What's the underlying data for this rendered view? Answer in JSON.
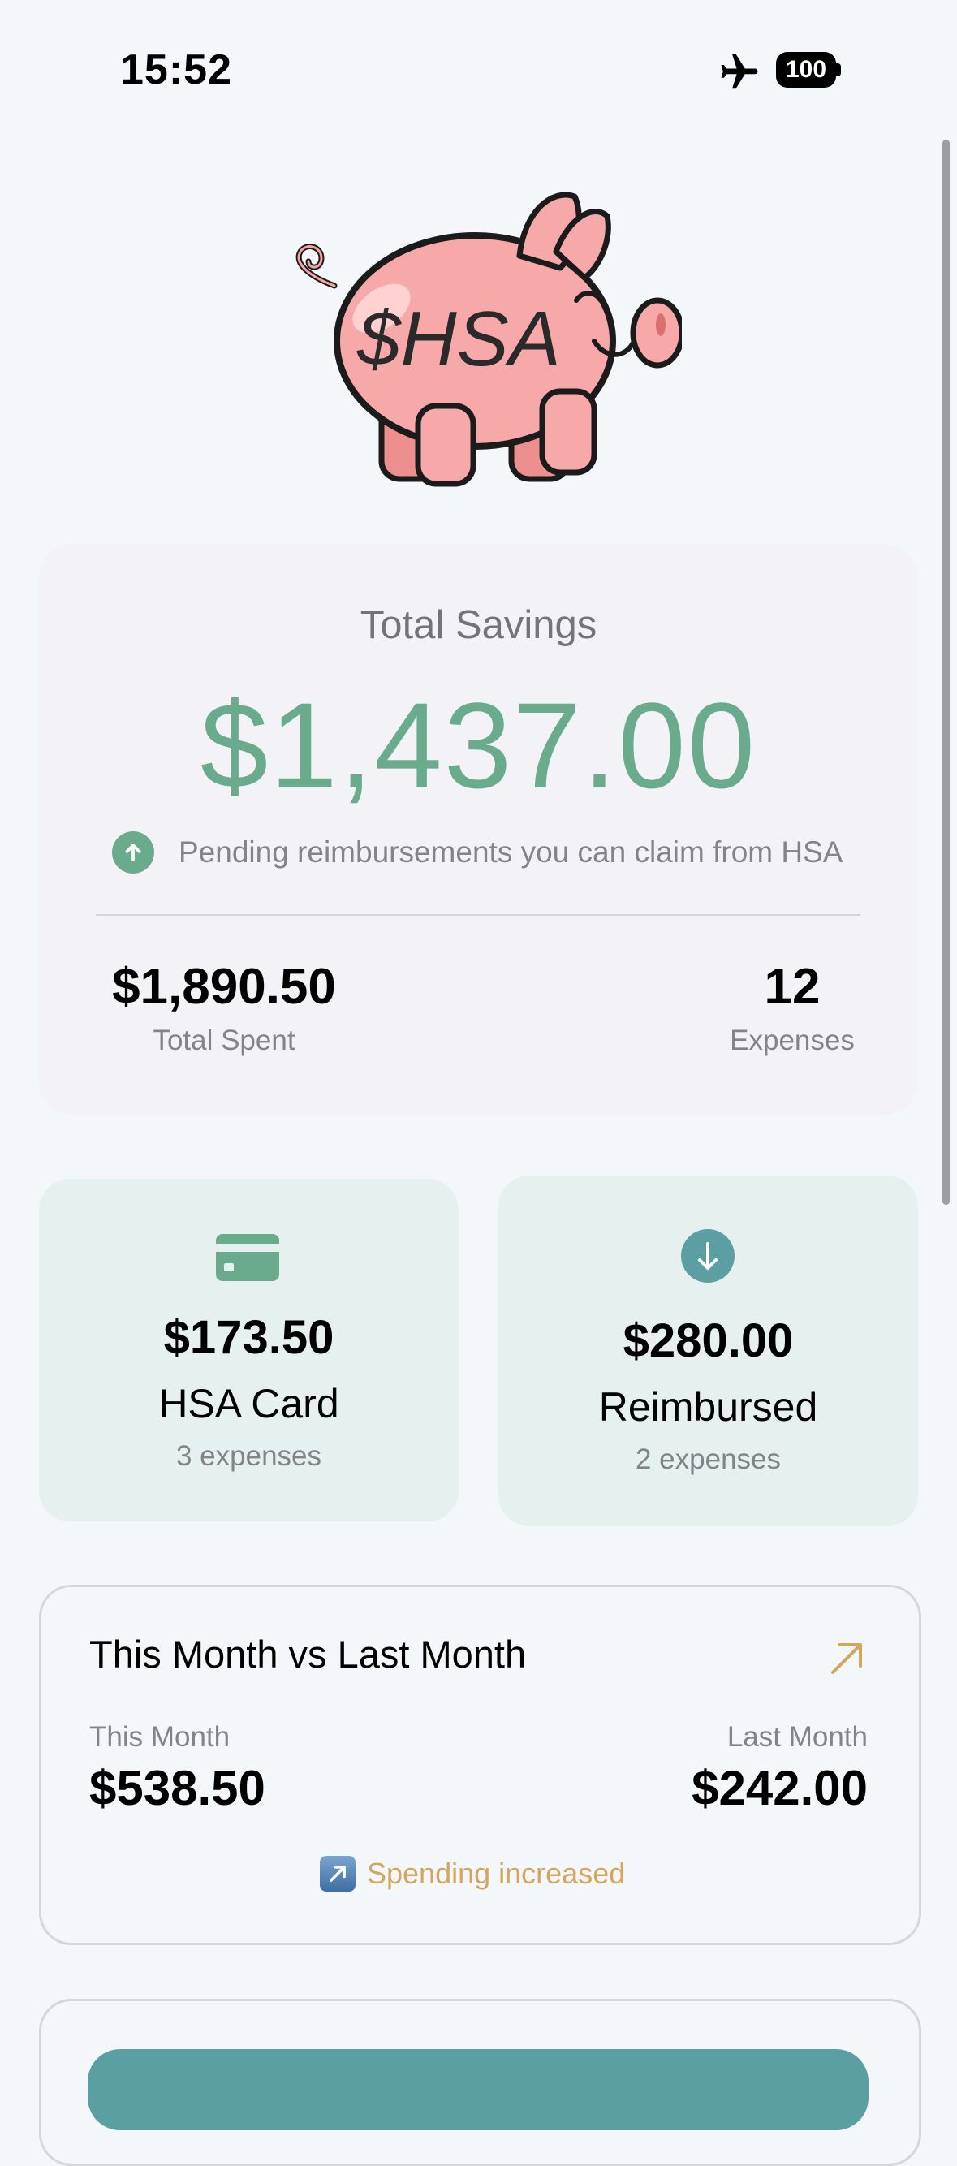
{
  "status_bar": {
    "time": "15:52",
    "battery": "100",
    "airplane_icon": "airplane-icon"
  },
  "hero": {
    "piggy_text": "$HSA"
  },
  "savings": {
    "title": "Total Savings",
    "amount": "$1,437.00",
    "pending_text": "Pending reimbursements you can claim from HSA",
    "total_spent_value": "$1,890.50",
    "total_spent_label": "Total Spent",
    "expenses_value": "12",
    "expenses_label": "Expenses",
    "accent_color": "#6aab8d"
  },
  "hsa_card": {
    "icon": "credit-card-icon",
    "amount": "$173.50",
    "label": "HSA Card",
    "sub": "3 expenses"
  },
  "reimbursed": {
    "icon": "arrow-down-circle-icon",
    "amount": "$280.00",
    "label": "Reimbursed",
    "sub": "2 expenses"
  },
  "comparison": {
    "title": "This Month vs Last Month",
    "this_month_label": "This Month",
    "this_month_value": "$538.50",
    "last_month_label": "Last Month",
    "last_month_value": "$242.00",
    "trend_text": "Spending increased",
    "trend_color": "#d4a55c"
  }
}
